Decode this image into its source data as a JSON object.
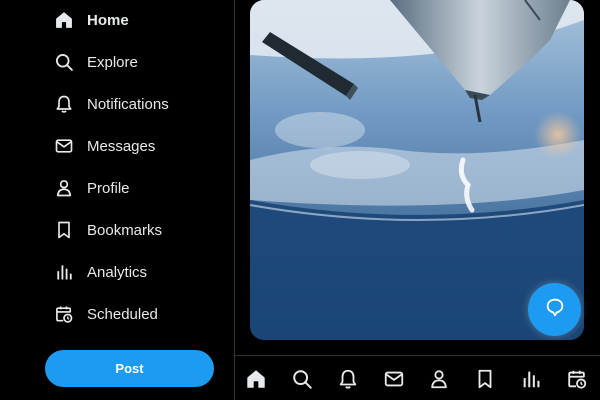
{
  "sidebar": {
    "items": [
      {
        "label": "Home",
        "icon": "home-icon",
        "active": true
      },
      {
        "label": "Explore",
        "icon": "search-icon"
      },
      {
        "label": "Notifications",
        "icon": "bell-icon"
      },
      {
        "label": "Messages",
        "icon": "envelope-icon"
      },
      {
        "label": "Profile",
        "icon": "person-icon"
      },
      {
        "label": "Bookmarks",
        "icon": "bookmark-icon"
      },
      {
        "label": "Analytics",
        "icon": "bar-chart-icon"
      },
      {
        "label": "Scheduled",
        "icon": "calendar-clock-icon"
      }
    ],
    "post_label": "Post"
  },
  "bottom_nav": {
    "icons": [
      "home-icon",
      "search-icon",
      "bell-icon",
      "envelope-icon",
      "person-icon",
      "bookmark-icon",
      "bar-chart-icon",
      "calendar-clock-icon"
    ]
  },
  "colors": {
    "accent": "#1d9bf0",
    "background": "#000000",
    "text": "#e7e9ea",
    "divider": "#2f3336"
  }
}
